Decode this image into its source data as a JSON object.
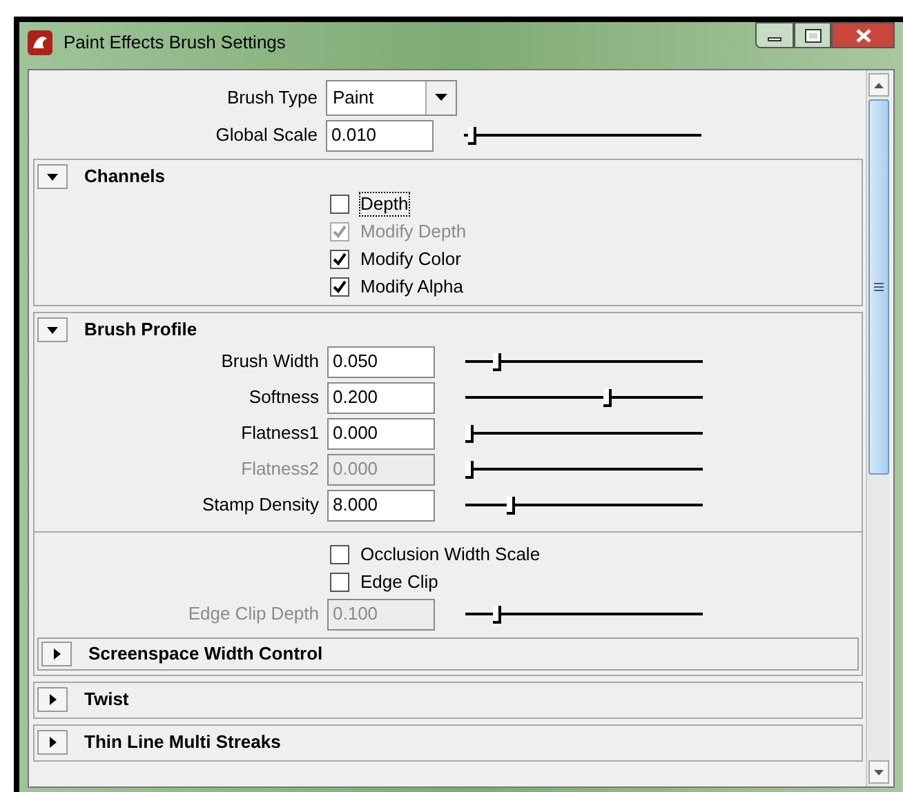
{
  "window": {
    "title": "Paint Effects Brush Settings"
  },
  "top_rows": [
    {
      "kind": "dropdown",
      "label": "Brush Type",
      "value": "Paint"
    },
    {
      "kind": "slider",
      "label": "Global Scale",
      "value": "0.010",
      "level": 0.02,
      "disabled": false
    }
  ],
  "sections": [
    {
      "label": "Channels",
      "expanded": true,
      "rows": [
        {
          "kind": "checkbox",
          "label": "Depth",
          "checked": false,
          "disabled": false,
          "focused": true
        },
        {
          "kind": "checkbox",
          "label": "Modify Depth",
          "checked": true,
          "disabled": true,
          "focused": false
        },
        {
          "kind": "checkbox",
          "label": "Modify Color",
          "checked": true,
          "disabled": false,
          "focused": false
        },
        {
          "kind": "checkbox",
          "label": "Modify Alpha",
          "checked": true,
          "disabled": false,
          "focused": false
        }
      ]
    },
    {
      "label": "Brush Profile",
      "expanded": true,
      "rows": [
        {
          "kind": "slider",
          "label": "Brush Width",
          "value": "0.050",
          "level": 0.12,
          "disabled": false
        },
        {
          "kind": "slider",
          "label": "Softness",
          "value": "0.200",
          "level": 0.6,
          "disabled": false
        },
        {
          "kind": "slider",
          "label": "Flatness1",
          "value": "0.000",
          "level": 0.0,
          "disabled": false
        },
        {
          "kind": "slider",
          "label": "Flatness2",
          "value": "0.000",
          "level": 0.0,
          "disabled": true
        },
        {
          "kind": "slider",
          "label": "Stamp Density",
          "value": "8.000",
          "level": 0.18,
          "disabled": false
        },
        {
          "kind": "divider"
        },
        {
          "kind": "checkbox",
          "label": "Occlusion Width Scale",
          "checked": false,
          "disabled": false,
          "focused": false
        },
        {
          "kind": "checkbox",
          "label": "Edge Clip",
          "checked": false,
          "disabled": false,
          "focused": false
        },
        {
          "kind": "slider",
          "label": "Edge Clip Depth",
          "value": "0.100",
          "level": 0.12,
          "disabled": true
        },
        {
          "kind": "section",
          "label": "Screenspace Width Control",
          "expanded": false
        }
      ]
    },
    {
      "label": "Twist",
      "expanded": false
    },
    {
      "label": "Thin Line Multi Streaks",
      "expanded": false
    }
  ]
}
